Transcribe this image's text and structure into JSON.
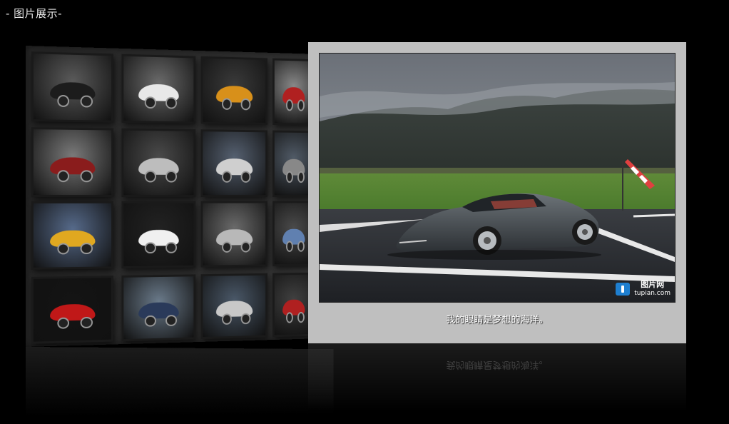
{
  "header": {
    "title": "- 图片展示-"
  },
  "gallery": {
    "thumbnails": [
      {
        "name": "thumb-black-supercar",
        "bg": "#5a5a5a",
        "car": "#1c1c1c"
      },
      {
        "name": "thumb-white-concept",
        "bg": "#6a6a6a",
        "car": "#e8e8e8"
      },
      {
        "name": "thumb-orange-supercar",
        "bg": "#3a3a3a",
        "car": "#d8901a"
      },
      {
        "name": "thumb-type-r",
        "bg": "#888888",
        "car": "#b02020"
      },
      {
        "name": "thumb-red-bugatti",
        "bg": "#7a7a7a",
        "car": "#8a1c1c"
      },
      {
        "name": "thumb-silver-roadster",
        "bg": "#4a4a4a",
        "car": "#bdbdbd"
      },
      {
        "name": "thumb-silver-coupe-mountain",
        "bg": "#556070",
        "car": "#cfcfcf"
      },
      {
        "name": "thumb-partial-1",
        "bg": "#505a66",
        "car": "#888888"
      },
      {
        "name": "thumb-yellow-lamborghini",
        "bg": "#566a8a",
        "car": "#e0a820"
      },
      {
        "name": "thumb-white-porsche",
        "bg": "#222222",
        "car": "#f0f0f0"
      },
      {
        "name": "thumb-silver-alfa",
        "bg": "#6a6a6a",
        "car": "#b8b8b8"
      },
      {
        "name": "thumb-partial-2",
        "bg": "#4a4a4a",
        "car": "#6080b0"
      },
      {
        "name": "thumb-red-ferrari",
        "bg": "#141414",
        "car": "#c01818"
      },
      {
        "name": "thumb-blue-beetle",
        "bg": "#6a7a8a",
        "car": "#2a3a5a"
      },
      {
        "name": "thumb-silver-convertible",
        "bg": "#4a5868",
        "car": "#c8c8c8"
      },
      {
        "name": "thumb-partial-3",
        "bg": "#404040",
        "car": "#b02020"
      }
    ]
  },
  "viewer": {
    "caption": "我的眼睛是梦想的海洋。",
    "watermark": {
      "title": "图片网",
      "url": "tupian.com"
    }
  },
  "colors": {
    "background": "#000000",
    "viewer_frame": "#bfbfbf",
    "watermark_blue": "#1e7fd0"
  }
}
